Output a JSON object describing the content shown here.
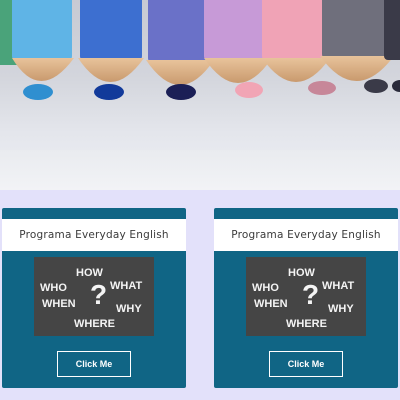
{
  "hero": {
    "image": "colored-pencils-photo",
    "pencil_colors": [
      "#4aa37a",
      "#5fb4e6",
      "#3d6fd0",
      "#6a71c8",
      "#c79ad7",
      "#f0a3b6",
      "#c7879a",
      "#6f6f7c"
    ]
  },
  "cards": [
    {
      "title": "Programa Everyday English",
      "image": "question-words-chalkboard",
      "image_words": {
        "how": "HOW",
        "what": "WHAT",
        "who": "WHO",
        "when": "WHEN",
        "why": "WHY",
        "where": "WHERE",
        "q": "?"
      },
      "button_label": "Click Me"
    },
    {
      "title": "Programa Everyday English",
      "image": "question-words-chalkboard",
      "image_words": {
        "how": "HOW",
        "what": "WHAT",
        "who": "WHO",
        "when": "WHEN",
        "why": "WHY",
        "where": "WHERE",
        "q": "?"
      },
      "button_label": "Click Me"
    }
  ],
  "colors": {
    "card_bg": "#106585",
    "page_bg": "#e3e1fa"
  }
}
